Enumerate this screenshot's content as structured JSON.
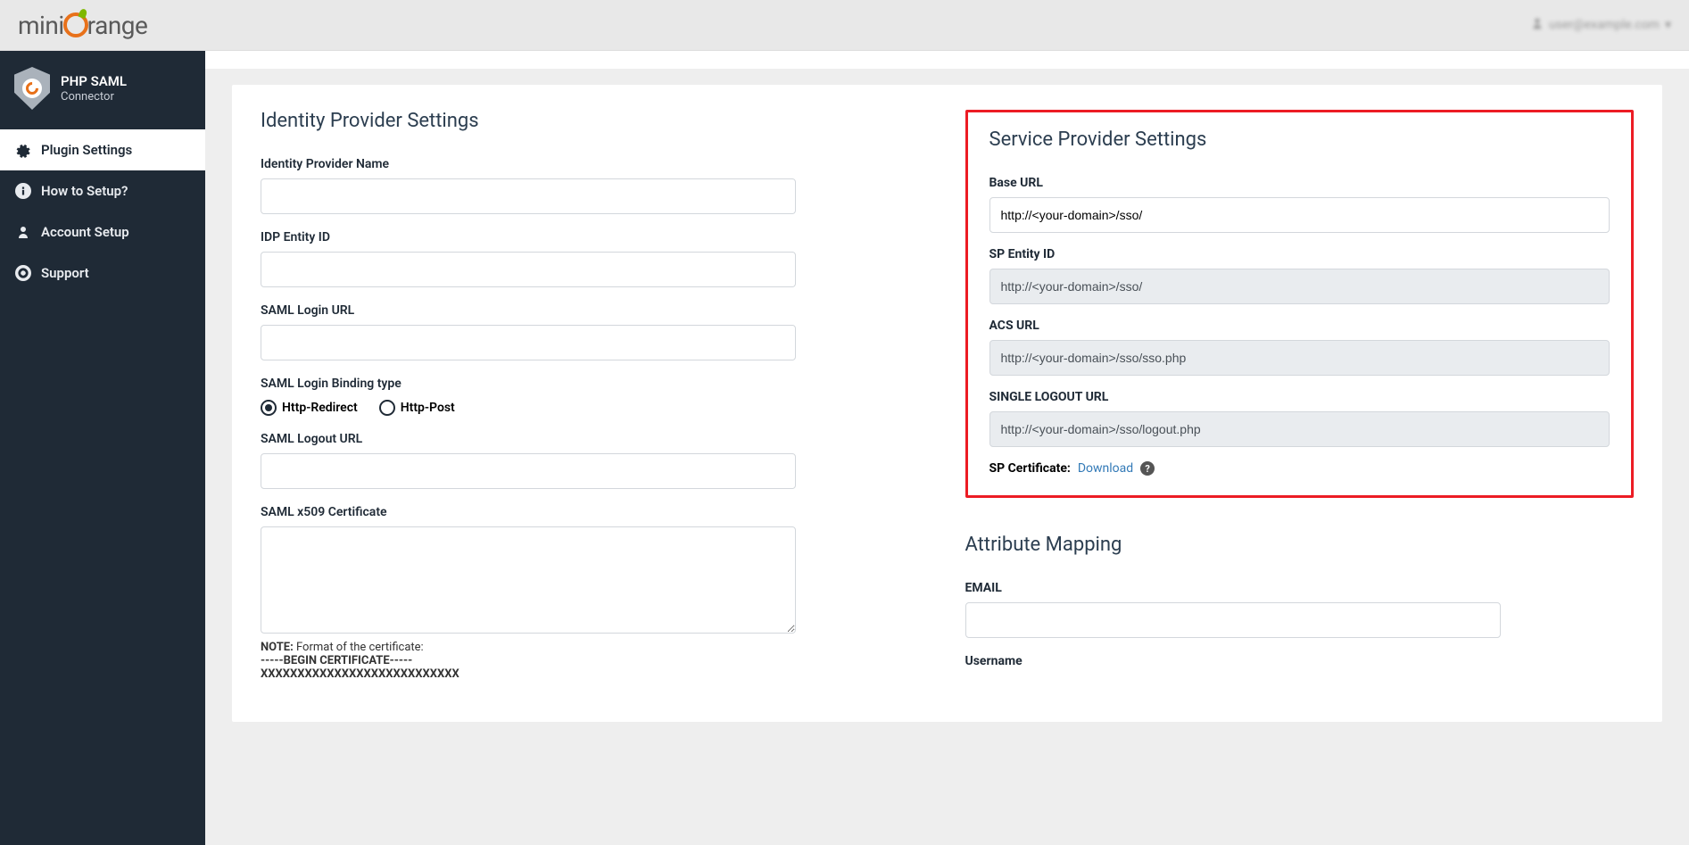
{
  "header": {
    "logo_prefix": "mini",
    "logo_suffix": "range",
    "user_text": "user@example.com"
  },
  "sidebar": {
    "title": "PHP SAML",
    "subtitle": "Connector",
    "items": [
      {
        "label": "Plugin Settings",
        "icon": "gear"
      },
      {
        "label": "How to Setup?",
        "icon": "info"
      },
      {
        "label": "Account Setup",
        "icon": "user"
      },
      {
        "label": "Support",
        "icon": "life-ring"
      }
    ]
  },
  "idp": {
    "title": "Identity Provider Settings",
    "name_label": "Identity Provider Name",
    "name_value": "",
    "entity_label": "IDP Entity ID",
    "entity_value": "",
    "login_url_label": "SAML Login URL",
    "login_url_value": "",
    "binding_label": "SAML Login Binding type",
    "radio_redirect": "Http-Redirect",
    "radio_post": "Http-Post",
    "logout_url_label": "SAML Logout URL",
    "logout_url_value": "",
    "cert_label": "SAML x509 Certificate",
    "cert_value": "",
    "note_label": "NOTE:",
    "note_text": " Format of the certificate:",
    "cert_begin": "-----BEGIN CERTIFICATE-----",
    "cert_sample": "XXXXXXXXXXXXXXXXXXXXXXXXXXX"
  },
  "sp": {
    "title": "Service Provider Settings",
    "base_url_label": "Base URL",
    "base_url_value": "http://<your-domain>/sso/",
    "entity_label": "SP Entity ID",
    "entity_value": "http://<your-domain>/sso/",
    "acs_label": "ACS URL",
    "acs_value": "http://<your-domain>/sso/sso.php",
    "slo_label": "SINGLE LOGOUT URL",
    "slo_value": "http://<your-domain>/sso/logout.php",
    "cert_label": "SP Certificate:",
    "download": "Download"
  },
  "attr": {
    "title": "Attribute Mapping",
    "email_label": "EMAIL",
    "email_value": "",
    "username_label": "Username"
  }
}
